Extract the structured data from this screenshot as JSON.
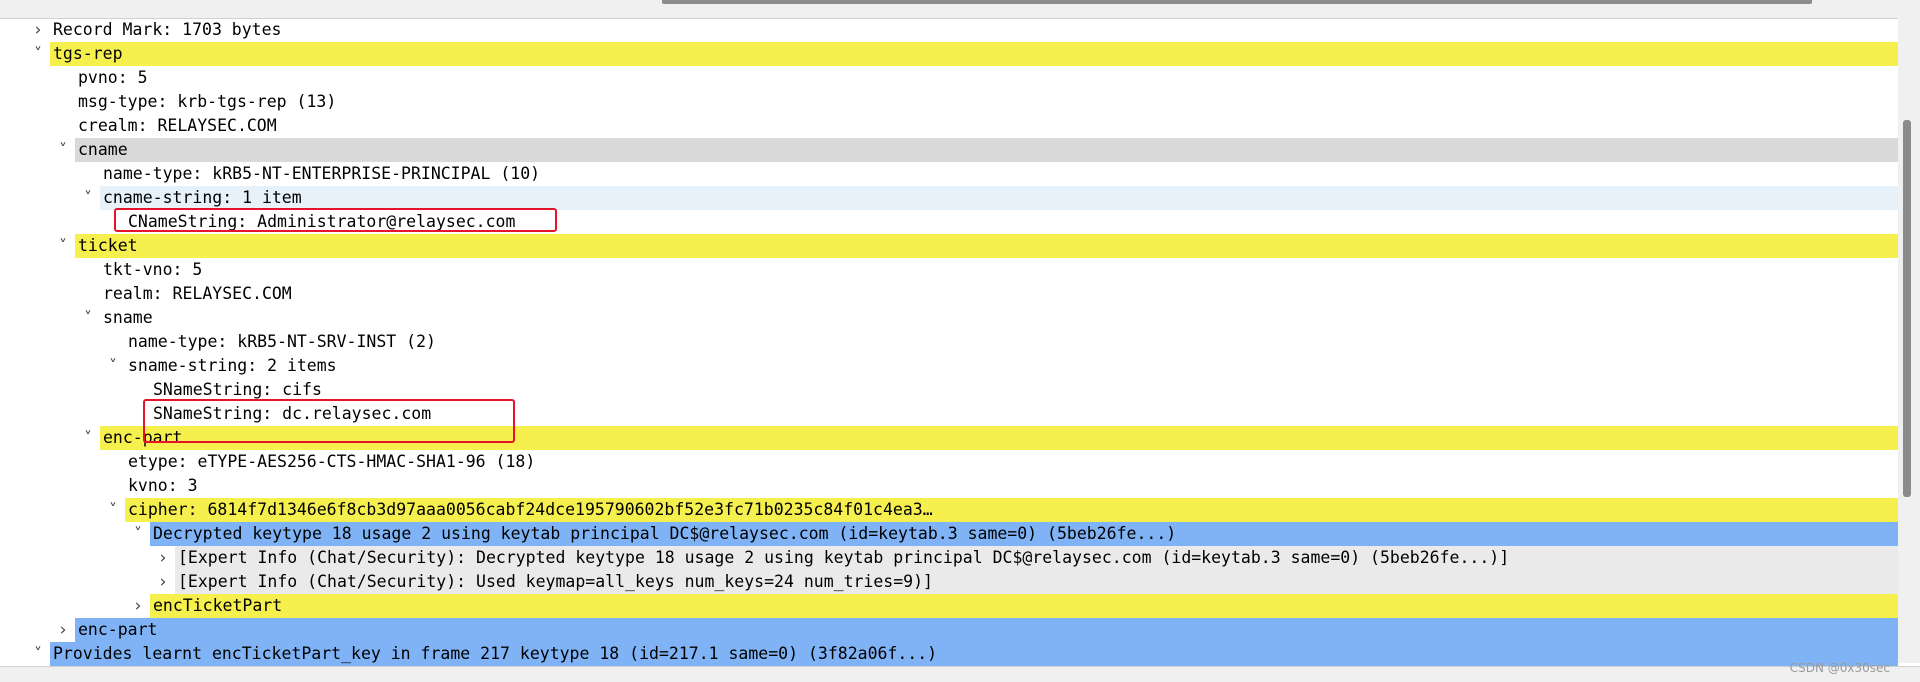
{
  "colors": {
    "yellow": "#f5f04e",
    "blue": "#7fb3f5",
    "grey": "#d9d9d9",
    "lightblue": "#e6f1fa",
    "lightgrey": "#eaeaea",
    "highlight_box": "#e8132a"
  },
  "tree": {
    "rows": [
      {
        "depth": 0,
        "toggle": "collapsed",
        "text": "Record Mark: 1703 bytes",
        "bg": "none"
      },
      {
        "depth": 0,
        "toggle": "expanded",
        "text": "tgs-rep",
        "bg": "yellow"
      },
      {
        "depth": 1,
        "toggle": "none",
        "text": "pvno: 5",
        "bg": "none"
      },
      {
        "depth": 1,
        "toggle": "none",
        "text": "msg-type: krb-tgs-rep (13)",
        "bg": "none"
      },
      {
        "depth": 1,
        "toggle": "none",
        "text": "crealm: RELAYSEC.COM",
        "bg": "none"
      },
      {
        "depth": 1,
        "toggle": "expanded",
        "text": "cname",
        "bg": "grey"
      },
      {
        "depth": 2,
        "toggle": "none",
        "text": "name-type: kRB5-NT-ENTERPRISE-PRINCIPAL (10)",
        "bg": "none"
      },
      {
        "depth": 2,
        "toggle": "expanded",
        "text": "cname-string: 1 item",
        "bg": "lightblue"
      },
      {
        "depth": 3,
        "toggle": "none",
        "text": "CNameString: Administrator@relaysec.com",
        "bg": "none"
      },
      {
        "depth": 1,
        "toggle": "expanded",
        "text": "ticket",
        "bg": "yellow"
      },
      {
        "depth": 2,
        "toggle": "none",
        "text": "tkt-vno: 5",
        "bg": "none"
      },
      {
        "depth": 2,
        "toggle": "none",
        "text": "realm: RELAYSEC.COM",
        "bg": "none"
      },
      {
        "depth": 2,
        "toggle": "expanded",
        "text": "sname",
        "bg": "none"
      },
      {
        "depth": 3,
        "toggle": "none",
        "text": "name-type: kRB5-NT-SRV-INST (2)",
        "bg": "none"
      },
      {
        "depth": 3,
        "toggle": "expanded",
        "text": "sname-string: 2 items",
        "bg": "none"
      },
      {
        "depth": 4,
        "toggle": "none",
        "text": "SNameString: cifs",
        "bg": "none"
      },
      {
        "depth": 4,
        "toggle": "none",
        "text": "SNameString: dc.relaysec.com",
        "bg": "none"
      },
      {
        "depth": 2,
        "toggle": "expanded",
        "text": "enc-part",
        "bg": "yellow"
      },
      {
        "depth": 3,
        "toggle": "none",
        "text": "etype: eTYPE-AES256-CTS-HMAC-SHA1-96 (18)",
        "bg": "none"
      },
      {
        "depth": 3,
        "toggle": "none",
        "text": "kvno: 3",
        "bg": "none"
      },
      {
        "depth": 3,
        "toggle": "expanded",
        "text": "cipher: 6814f7d1346e6f8cb3d97aaa0056cabf24dce195790602bf52e3fc71b0235c84f01c4ea3…",
        "bg": "yellow"
      },
      {
        "depth": 4,
        "toggle": "expanded",
        "text": "Decrypted keytype 18 usage 2 using keytab principal DC$@relaysec.com (id=keytab.3 same=0) (5beb26fe...)",
        "bg": "blue"
      },
      {
        "depth": 5,
        "toggle": "collapsed",
        "text": "[Expert Info (Chat/Security): Decrypted keytype 18 usage 2 using keytab principal DC$@relaysec.com (id=keytab.3 same=0) (5beb26fe...)]",
        "bg": "lightgrey"
      },
      {
        "depth": 5,
        "toggle": "collapsed",
        "text": "[Expert Info (Chat/Security): Used keymap=all_keys num_keys=24 num_tries=9)]",
        "bg": "lightgrey"
      },
      {
        "depth": 4,
        "toggle": "collapsed",
        "text": "encTicketPart",
        "bg": "yellow"
      },
      {
        "depth": 1,
        "toggle": "collapsed",
        "text": "enc-part",
        "bg": "blue"
      },
      {
        "depth": 0,
        "toggle": "expanded",
        "text": "Provides learnt encTicketPart_key in frame 217 keytype 18 (id=217.1 same=0) (3f82a06f...)",
        "bg": "blue"
      }
    ]
  },
  "watermark": "CSDN @0x30sec"
}
